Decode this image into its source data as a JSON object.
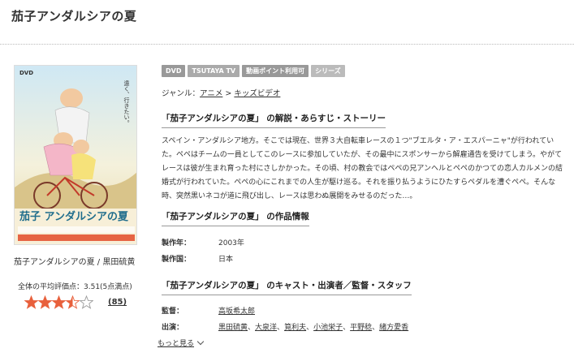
{
  "page": {
    "title": "茄子アンダルシアの夏"
  },
  "poster": {
    "dvd_mark": "DVD",
    "tagline": "遠く、行きたい。",
    "logo_text": "茄子 アンダルシアの夏",
    "caption": "茄子アンダルシアの夏 / 黒田硫黄"
  },
  "rating": {
    "label": "全体の平均評価点：3.51(5点満点)",
    "value": 3.51,
    "max": 5,
    "review_count": "(85)",
    "star_color": "#e8603c"
  },
  "badges": [
    "DVD",
    "TSUTAYA TV",
    "動画ポイント利用可",
    "シリーズ"
  ],
  "genre": {
    "prefix": "ジャンル：",
    "items": [
      "アニメ",
      "キッズビデオ"
    ],
    "separator": ">"
  },
  "sections": {
    "story_heading": "「茄子アンダルシアの夏」 の解説・あらすじ・ストーリー",
    "story_text": "スペイン・アンダルシア地方。そこでは現在、世界３大自転車レースの１つ\"ブエルタ・ア・エスパーニャ\"が行われていた。ペペはチームの一員としてこのレースに参加していたが、その最中にスポンサーから解雇通告を受けてしまう。やがてレースは彼が生まれ育った村にさしかかった。その頃、村の教会ではペペの兄アンヘルとペペのかつての恋人カルメンの結婚式が行われていた。ペペの心にこれまでの人生が駆け巡る。それを振り払うようにひたすらペダルを漕ぐペペ。そんな時、突然黒いネコが道に飛び出し、レースは思わぬ展開をみせるのだった…。",
    "info_heading": "「茄子アンダルシアの夏」 の作品情報",
    "info": {
      "year_label": "製作年：",
      "year": "2003年",
      "country_label": "製作国：",
      "country": "日本"
    },
    "cast_heading": "「茄子アンダルシアの夏」 のキャスト・出演者／監督・スタッフ",
    "cast": {
      "director_label": "監督：",
      "director": "高坂希太郎",
      "cast_label": "出演：",
      "cast_names": [
        "黒田硫黄",
        "大泉洋",
        "筧利夫",
        "小池栄子",
        "平野稔",
        "緒方愛香"
      ],
      "separator": "、"
    },
    "more_label": "もっと見る"
  }
}
